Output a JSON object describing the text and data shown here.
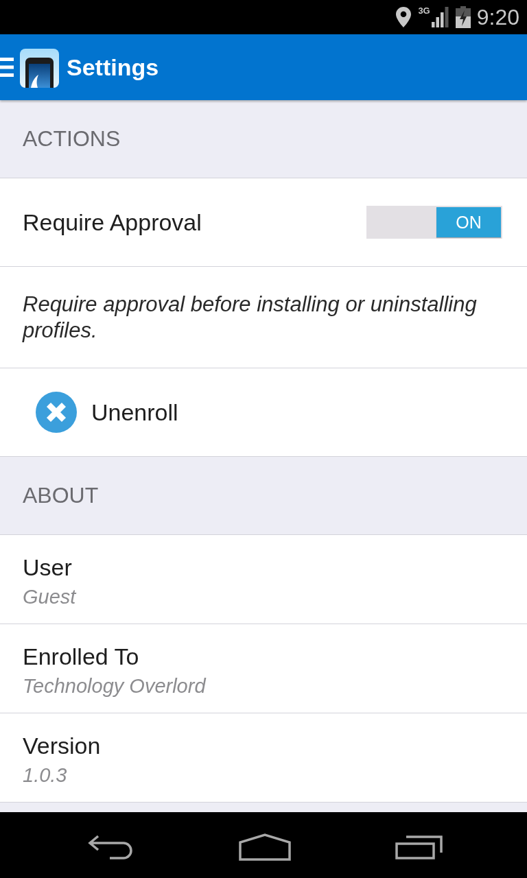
{
  "status_bar": {
    "network_type": "3G",
    "time": "9:20"
  },
  "app_bar": {
    "title": "Settings"
  },
  "sections": [
    {
      "header": "ACTIONS",
      "items": [
        {
          "kind": "toggle",
          "label": "Require Approval",
          "on": true,
          "toggle_text": "ON"
        },
        {
          "kind": "description",
          "text": "Require approval before installing or uninstalling profiles."
        },
        {
          "kind": "action",
          "label": "Unenroll"
        }
      ]
    },
    {
      "header": "ABOUT",
      "items": [
        {
          "kind": "info",
          "label": "User",
          "value": "Guest"
        },
        {
          "kind": "info",
          "label": "Enrolled To",
          "value": "Technology Overlord"
        },
        {
          "kind": "info",
          "label": "Version",
          "value": "1.0.3"
        }
      ]
    }
  ]
}
